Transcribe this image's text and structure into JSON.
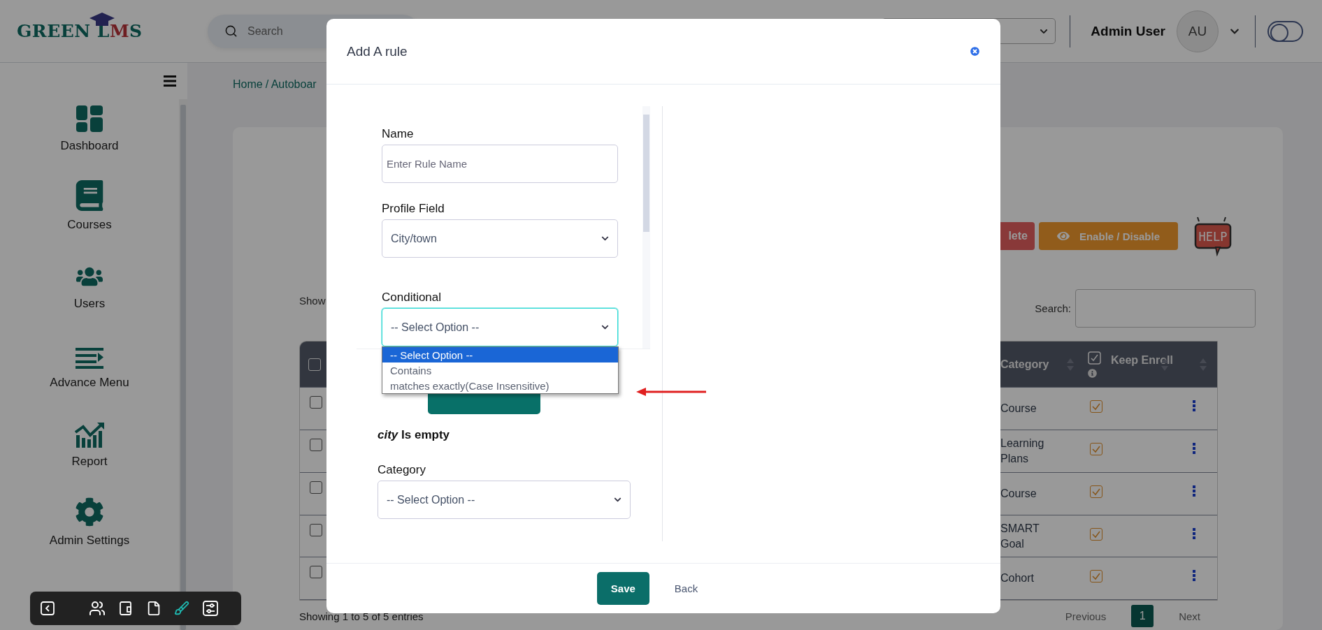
{
  "header": {
    "logo": {
      "text": "GREEN L",
      "mark": "M",
      "end": "S"
    },
    "search": {
      "placeholder": "Search"
    },
    "user": {
      "name": "Admin User",
      "initials": "AU"
    },
    "theme_toggle": {
      "on": false
    }
  },
  "sidebar": {
    "items": [
      {
        "label": "Dashboard"
      },
      {
        "label": "Courses"
      },
      {
        "label": "Users"
      },
      {
        "label": "Advance Menu"
      },
      {
        "label": "Report"
      },
      {
        "label": "Admin Settings"
      }
    ]
  },
  "toolbar": {
    "tools": [
      {
        "selected": false
      },
      {
        "selected": false
      },
      {
        "selected": false
      },
      {
        "selected": false
      },
      {
        "selected": true
      },
      {
        "selected": false
      }
    ]
  },
  "breadcrumb": [
    "Home",
    "/ Autoboar"
  ],
  "actions": [
    {
      "label": "lete",
      "kind": "danger"
    },
    {
      "label": "Enable / Disable",
      "kind": "warning"
    }
  ],
  "help_badge": "HELP",
  "table_controls": {
    "show_label": "Show",
    "search_label": "Search:"
  },
  "table": {
    "header_checked": false,
    "columns": [
      "Category",
      "Keep Enroll"
    ],
    "rows": [
      {
        "checked": false,
        "category": "Course",
        "keep_enroll": true
      },
      {
        "checked": false,
        "category": "Learning Plans",
        "keep_enroll": true
      },
      {
        "checked": false,
        "category": "Course",
        "keep_enroll": true
      },
      {
        "checked": false,
        "category": "SMART Goal",
        "keep_enroll": true
      },
      {
        "checked": false,
        "category": "Cohort",
        "keep_enroll": true
      }
    ]
  },
  "table_info": "Showing 1 to 5 of 5 entries",
  "pagination": {
    "previous": "Previous",
    "pages": [
      {
        "label": "1",
        "selected": true
      }
    ],
    "next": "Next"
  },
  "modal": {
    "title": "Add A rule",
    "fields": [
      {
        "kind": "input",
        "label": "Name",
        "placeholder": "Enter Rule Name"
      },
      {
        "kind": "select",
        "label": "Profile Field",
        "value": "City/town",
        "focused": false
      },
      {
        "kind": "select",
        "label": "Conditional",
        "value": "-- Select Option --",
        "focused": true,
        "options": [
          {
            "label": "-- Select Option --",
            "selected": true
          },
          {
            "label": "Contains",
            "selected": false
          },
          {
            "label": "matches exactly(Case Insensitive)",
            "selected": false
          }
        ]
      }
    ],
    "condition_text": "*city* Is empty",
    "category": {
      "label": "Category",
      "value": "-- Select Option --"
    },
    "save": "Save",
    "back": "Back"
  }
}
